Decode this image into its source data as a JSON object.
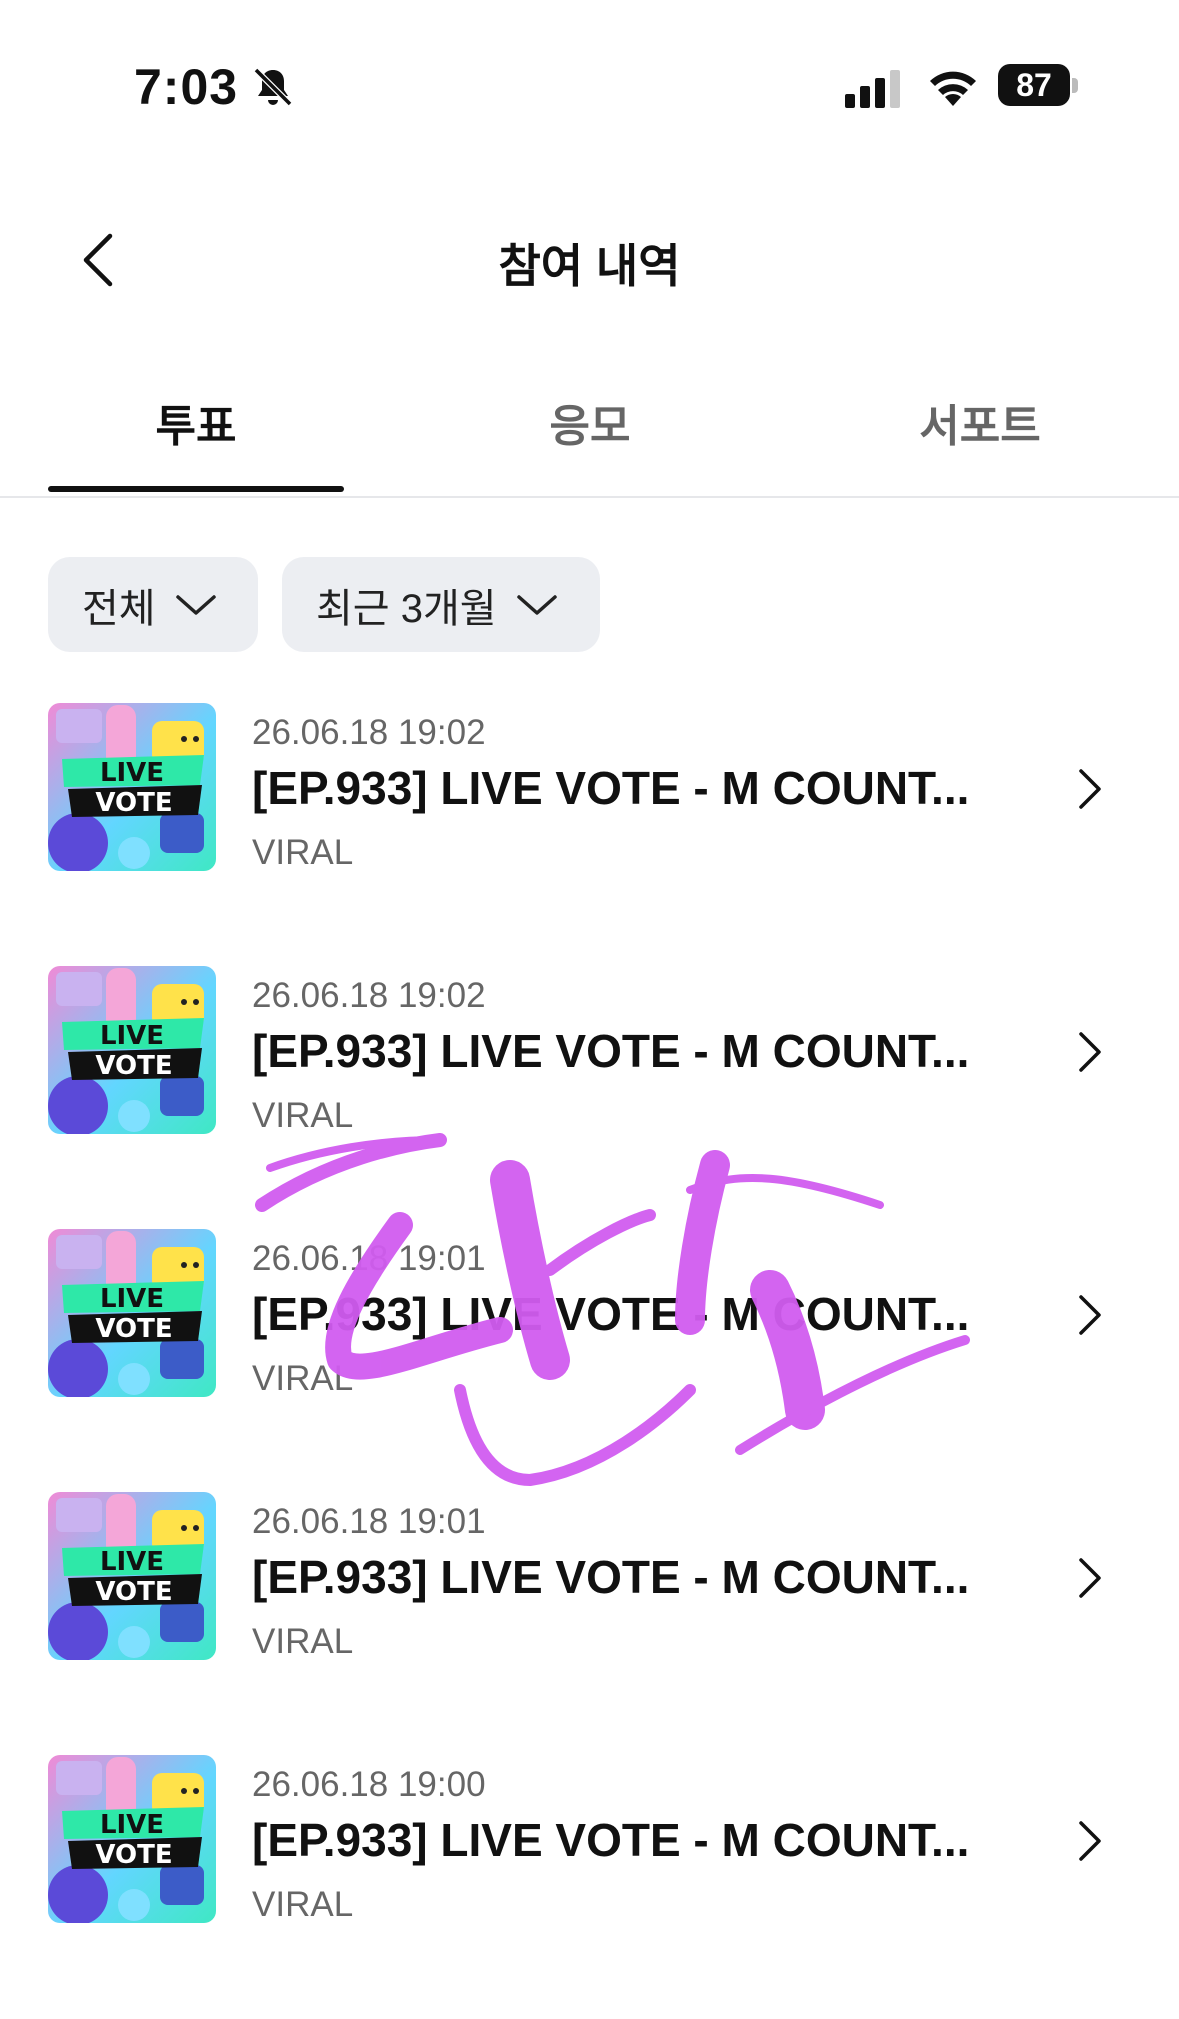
{
  "status_bar": {
    "time": "7:03",
    "battery": "87"
  },
  "header": {
    "title": "참여 내역"
  },
  "tabs": [
    {
      "label": "투표",
      "active": true
    },
    {
      "label": "응모",
      "active": false
    },
    {
      "label": "서포트",
      "active": false
    }
  ],
  "filters": {
    "category": "전체",
    "period": "최근 3개월"
  },
  "thumb": {
    "line1": "LIVE",
    "line2": "VOTE"
  },
  "items": [
    {
      "date": "26.06.18 19:02",
      "title": "[EP.933] LIVE VOTE - M COUNT...",
      "source": "VIRAL"
    },
    {
      "date": "26.06.18 19:02",
      "title": "[EP.933] LIVE VOTE - M COUNT...",
      "source": "VIRAL"
    },
    {
      "date": "26.06.18 19:01",
      "title": "[EP.933] LIVE VOTE - M COUNT...",
      "source": "VIRAL"
    },
    {
      "date": "26.06.18 19:01",
      "title": "[EP.933] LIVE VOTE - M COUNT...",
      "source": "VIRAL"
    },
    {
      "date": "26.06.18 19:00",
      "title": "[EP.933] LIVE VOTE - M COUNT...",
      "source": "VIRAL"
    }
  ],
  "colors": {
    "accent": "#111111",
    "chip_bg": "#eceef2",
    "scribble": "#d15cf0"
  }
}
